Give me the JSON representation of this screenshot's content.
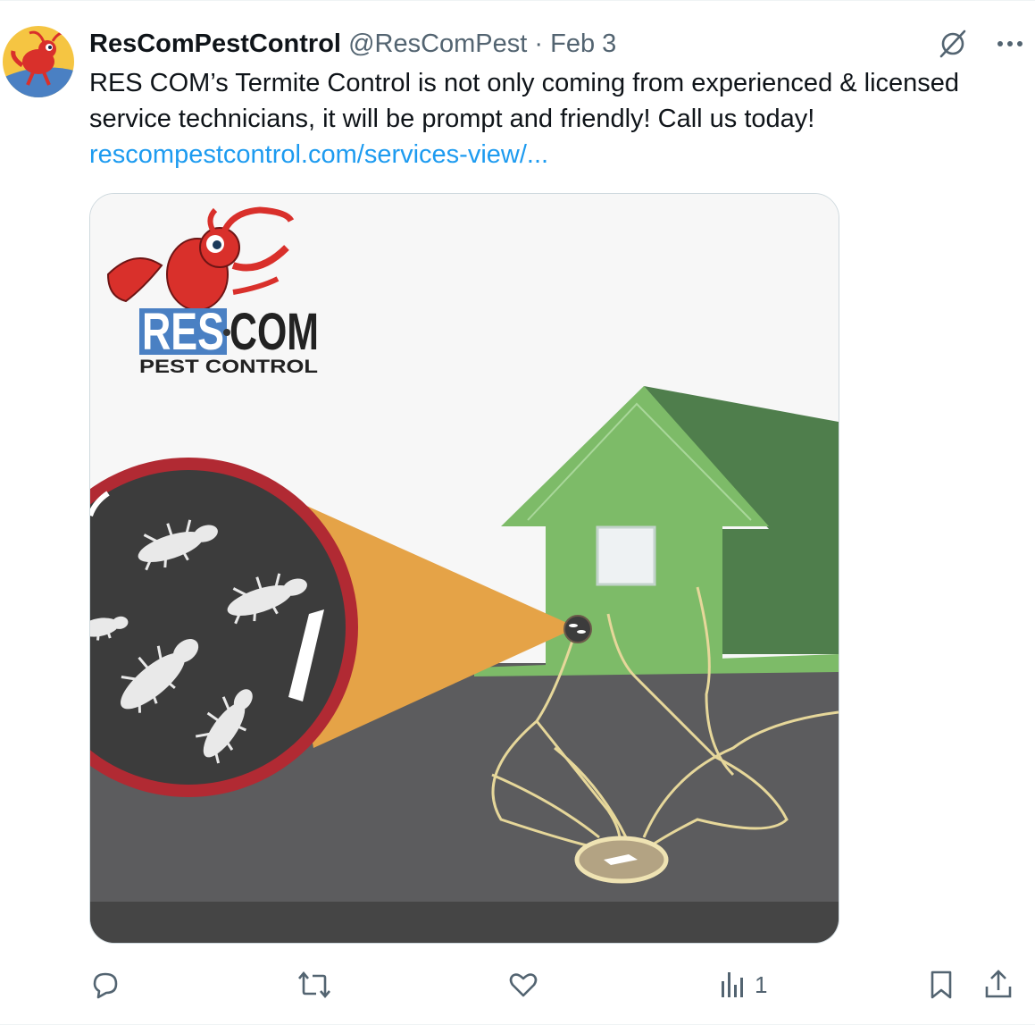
{
  "tweet": {
    "display_name": "ResComPestControl",
    "handle": "@ResComPest",
    "separator": "·",
    "date": "Feb 3",
    "text_line1": "RES COM’s Termite Control is not only coming from experienced & licensed",
    "text_line2": "service technicians, it will be prompt and friendly! Call us today!",
    "link_text": "rescompestcontrol.com/services-view/..."
  },
  "media": {
    "logo_word1": "RES",
    "logo_word2": "COM",
    "logo_tagline": "PEST CONTROL"
  },
  "actions": {
    "reply_icon": "reply-icon",
    "retweet_icon": "retweet-icon",
    "like_icon": "heart-icon",
    "views_icon": "views-chart-icon",
    "views_count": "1",
    "bookmark_icon": "bookmark-icon",
    "share_icon": "share-icon"
  },
  "colors": {
    "link": "#1d9bf0",
    "muted": "#536471",
    "house_light": "#7dbb68",
    "house_dark": "#4f7e4c",
    "ground": "#5c5c5e",
    "cone": "#e5a347",
    "lens_ring": "#b12a33",
    "logo_blue": "#4a80c3",
    "ant_red": "#d9302b"
  }
}
